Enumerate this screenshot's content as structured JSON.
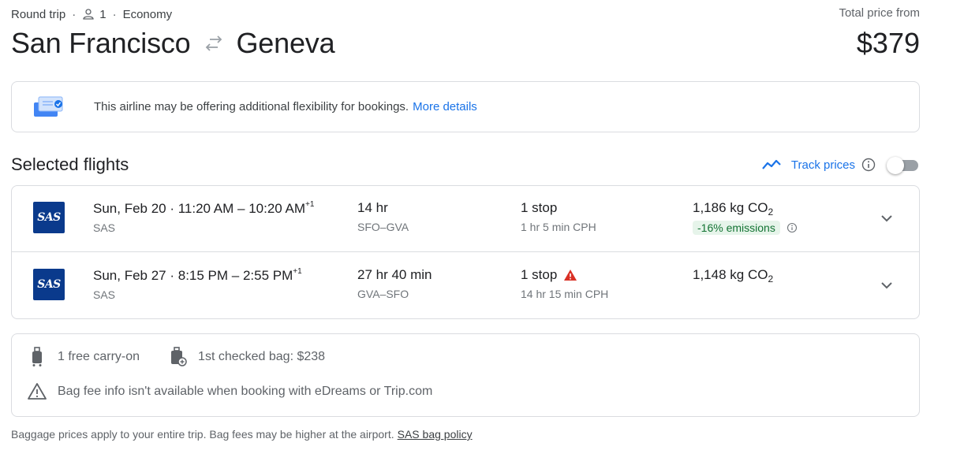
{
  "trip": {
    "type": "Round trip",
    "passengers": "1",
    "cabin": "Economy",
    "origin": "San Francisco",
    "destination": "Geneva"
  },
  "price": {
    "label": "Total price from",
    "value": "$379"
  },
  "notice": {
    "text": "This airline may be offering additional flexibility for bookings.",
    "link": "More details"
  },
  "section": {
    "title": "Selected flights",
    "track_label": "Track prices",
    "track_enabled": false
  },
  "flights": [
    {
      "airline_logo": "SAS",
      "date": "Sun, Feb 20",
      "times": "11:20 AM – 10:20 AM",
      "day_offset": "+1",
      "airline": "SAS",
      "duration": "14 hr",
      "route": "SFO–GVA",
      "stops": "1 stop",
      "layover": "1 hr 5 min CPH",
      "co2": "1,186 kg CO",
      "co2_sub": "2",
      "emissions": "-16% emissions"
    },
    {
      "airline_logo": "SAS",
      "date": "Sun, Feb 27",
      "times": "8:15 PM – 2:55 PM",
      "day_offset": "+1",
      "airline": "SAS",
      "duration": "27 hr 40 min",
      "route": "GVA–SFO",
      "stops": "1 stop",
      "layover": "14 hr 15 min CPH",
      "co2": "1,148 kg CO",
      "co2_sub": "2"
    }
  ],
  "bags": {
    "carry_on": "1 free carry-on",
    "checked": "1st checked bag: $238",
    "warning": "Bag fee info isn't available when booking with eDreams or Trip.com"
  },
  "footnote": {
    "text": "Baggage prices apply to your entire trip. Bag fees may be higher at the airport.",
    "link": "SAS bag policy"
  },
  "colors": {
    "accent": "#1a73e8",
    "sas_blue": "#0a3a8c",
    "warning_red": "#d93025",
    "emissions_green": "#137333"
  }
}
